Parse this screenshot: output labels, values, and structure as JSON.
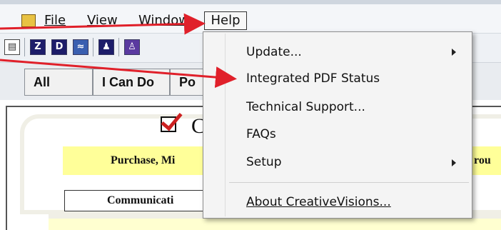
{
  "menubar": {
    "file": "File",
    "view": "View",
    "window": "Window",
    "help": "Help"
  },
  "toolbar": {
    "icons": [
      "document-icon",
      "list-icon",
      "d-icon",
      "chart-icon",
      "person-icon",
      "user-icon"
    ]
  },
  "tabs": [
    "All",
    "I Can Do",
    "Po"
  ],
  "background": {
    "title_fragment": "C",
    "purchase_fragment": "Purchase, Mi",
    "purchase_fragment2": "rou",
    "comm_fragment": "Communicati"
  },
  "help_menu": {
    "items": [
      {
        "label": "Update...",
        "submenu": true
      },
      {
        "label": "Integrated PDF Status",
        "submenu": false
      },
      {
        "label": "Technical Support...",
        "submenu": false
      },
      {
        "label": "FAQs",
        "submenu": false
      },
      {
        "label": "Setup",
        "submenu": true
      },
      {
        "label": "About CreativeVisions...",
        "submenu": false
      }
    ]
  },
  "colors": {
    "annotation_arrow": "#e0202a",
    "highlight_yellow": "#ffff99"
  }
}
